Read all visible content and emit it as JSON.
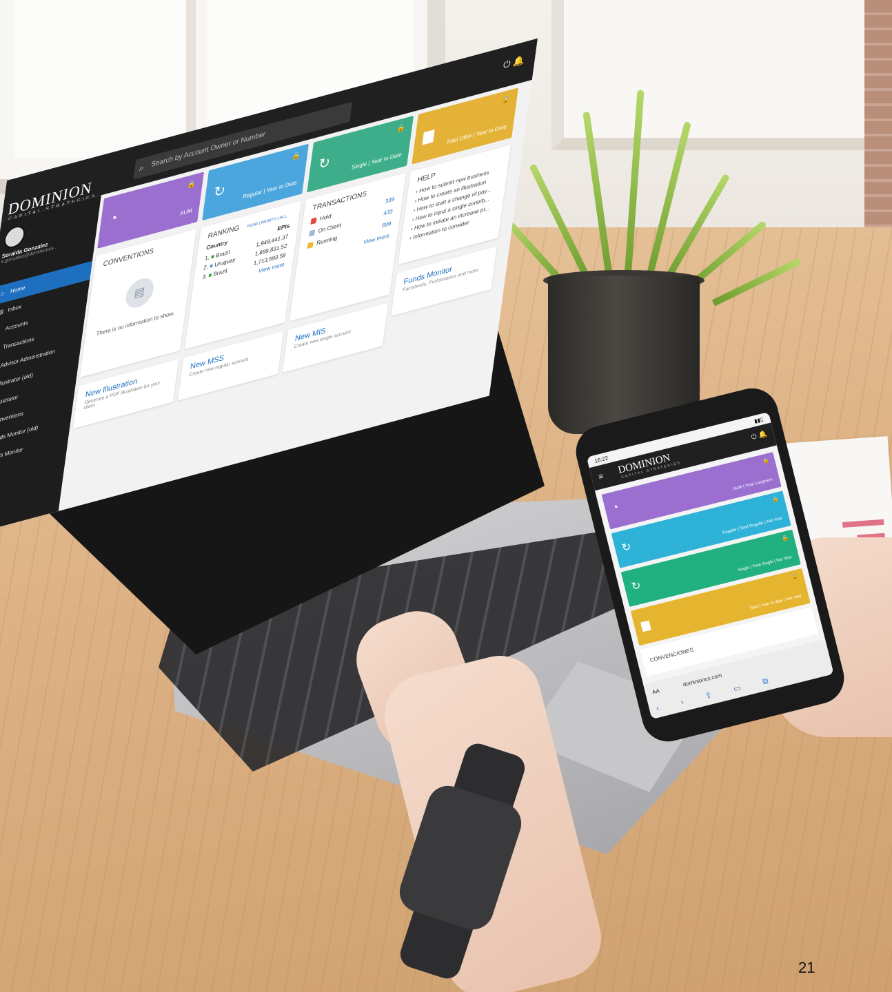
{
  "brand": {
    "name": "DOMINION",
    "tagline": "CAPITAL STRATEGIES"
  },
  "laptop": {
    "search_placeholder": "Search by Account Owner or Number",
    "user": {
      "name": "Soraida Gonzalez",
      "email": "s.gonzalez@dominioncs..."
    },
    "nav": [
      {
        "label": "Home",
        "icon": "home-icon"
      },
      {
        "label": "Inbox",
        "icon": "inbox-icon"
      },
      {
        "label": "Accounts",
        "icon": "folder-icon"
      },
      {
        "label": "Transactions",
        "icon": "document-icon"
      },
      {
        "label": "Advisor Administration",
        "icon": "user-gear-icon"
      },
      {
        "label": "Illustrator (old)",
        "icon": "illustrator-icon"
      },
      {
        "label": "Illustrator",
        "icon": "illustrator-icon"
      },
      {
        "label": "Conventions",
        "icon": "plane-icon"
      },
      {
        "label": "Funds Monitor (old)",
        "icon": "trend-icon"
      },
      {
        "label": "Funds Monitor",
        "icon": "trend-icon"
      }
    ],
    "tiles": [
      {
        "label": "AUM",
        "color": "#9b6fd0",
        "icon": "pie-chart-icon"
      },
      {
        "label": "Regular | Year to Date",
        "color": "#4aa6dc",
        "icon": "refresh-icon"
      },
      {
        "label": "Single | Year to Date",
        "color": "#3dad8a",
        "icon": "refresh-icon"
      },
      {
        "label": "Total Offer | Year to Date",
        "color": "#e4b236",
        "icon": "bar-chart-icon"
      }
    ],
    "conventions": {
      "title": "CONVENTIONS",
      "empty_text": "There is no information to show."
    },
    "ranking": {
      "title": "RANKING",
      "period": "YEAR | MONTH | ALL",
      "col_country": "Country",
      "col_eps": "EPts",
      "rows": [
        {
          "rank": "1.",
          "country": "Brazil",
          "value": "1,949,441.37"
        },
        {
          "rank": "2.",
          "country": "Uruguay",
          "value": "1,899,831.52"
        },
        {
          "rank": "3.",
          "country": "Brazil",
          "value": "1,713,593.58"
        }
      ],
      "view_more": "View more"
    },
    "transactions": {
      "title": "TRANSACTIONS",
      "rows": [
        {
          "label": "Hold",
          "count": "339",
          "color": "#e04a3f"
        },
        {
          "label": "On Client",
          "count": "433",
          "color": "#9fb8d6"
        },
        {
          "label": "Running",
          "count": "699",
          "color": "#f0b932"
        }
      ],
      "view_more": "View more"
    },
    "help": {
      "title": "HELP",
      "items": [
        "How to submit new business",
        "How to create an illustration",
        "How to start a change of pay...",
        "How to input a single contrib...",
        "How to initiate an increase pr...",
        "Information to consider"
      ]
    },
    "actions": [
      {
        "title": "New Illustration",
        "desc": "Generate a PDF illustration for your client"
      },
      {
        "title": "New MSS",
        "desc": "Create new regular account"
      },
      {
        "title": "New MIS",
        "desc": "Create new single account"
      },
      {
        "title": "Funds Monitor",
        "desc": "Factsheets, Performance and more"
      }
    ]
  },
  "phone": {
    "time": "16:22",
    "tiles": [
      {
        "label": "AUM | Total Livegreen",
        "color": "#9b6fd0",
        "icon": "pie-chart-icon"
      },
      {
        "label": "Regular | Total Regular | Net Year",
        "color": "#2fb2d8",
        "icon": "refresh-icon"
      },
      {
        "label": "Single | Total Single | Net Year",
        "color": "#21b07f",
        "icon": "refresh-icon"
      },
      {
        "label": "Total | Year to date | Net Year",
        "color": "#e6b52f",
        "icon": "bar-chart-icon"
      }
    ],
    "conventions_title": "CONVENCIONES",
    "url": "dominioncs.com",
    "text_size_btn": "AA"
  },
  "page_number": "21"
}
